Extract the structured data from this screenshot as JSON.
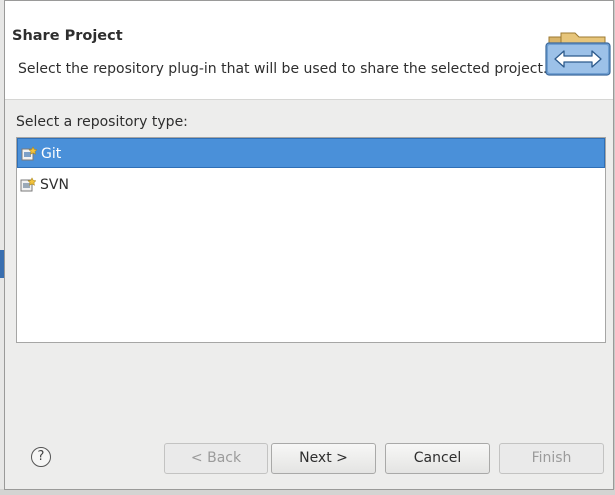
{
  "dialog": {
    "title": "Share Project",
    "description": "Select the repository plug-in that will be used to share the selected project."
  },
  "repository": {
    "label": "Select a repository type:",
    "items": [
      {
        "label": "Git",
        "selected": true,
        "icon": "git-repo-icon"
      },
      {
        "label": "SVN",
        "selected": false,
        "icon": "svn-repo-icon"
      }
    ]
  },
  "buttons": {
    "help": "?",
    "back": "< Back",
    "next": "Next >",
    "cancel": "Cancel",
    "finish": "Finish"
  },
  "colors": {
    "selection": "#4a90d9",
    "banner_bg": "#ffffff",
    "dialog_bg": "#ededec"
  }
}
